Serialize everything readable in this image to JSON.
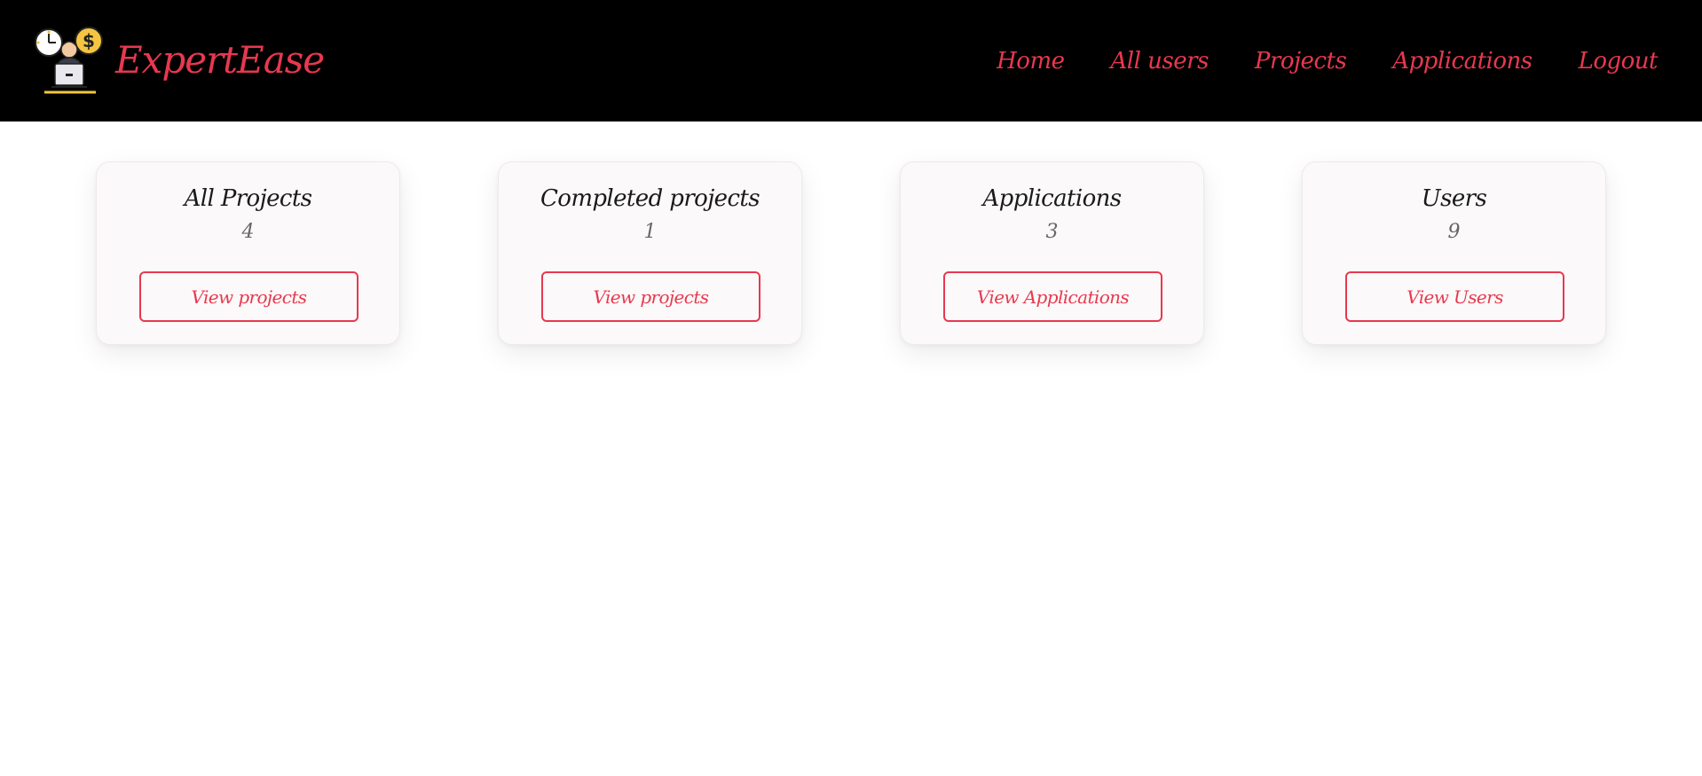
{
  "header": {
    "brand_name": "ExpertEase",
    "logo_icon": "freelancer-clock-money-laptop-icon",
    "accent_color": "#e8384f",
    "background_color": "#000000"
  },
  "nav": {
    "items": [
      {
        "label": "Home"
      },
      {
        "label": "All users"
      },
      {
        "label": "Projects"
      },
      {
        "label": "Applications"
      },
      {
        "label": "Logout"
      }
    ]
  },
  "cards": [
    {
      "title": "All Projects",
      "count": "4",
      "button_label": "View projects"
    },
    {
      "title": "Completed projects",
      "count": "1",
      "button_label": "View projects"
    },
    {
      "title": "Applications",
      "count": "3",
      "button_label": "View Applications"
    },
    {
      "title": "Users",
      "count": "9",
      "button_label": "View Users"
    }
  ]
}
